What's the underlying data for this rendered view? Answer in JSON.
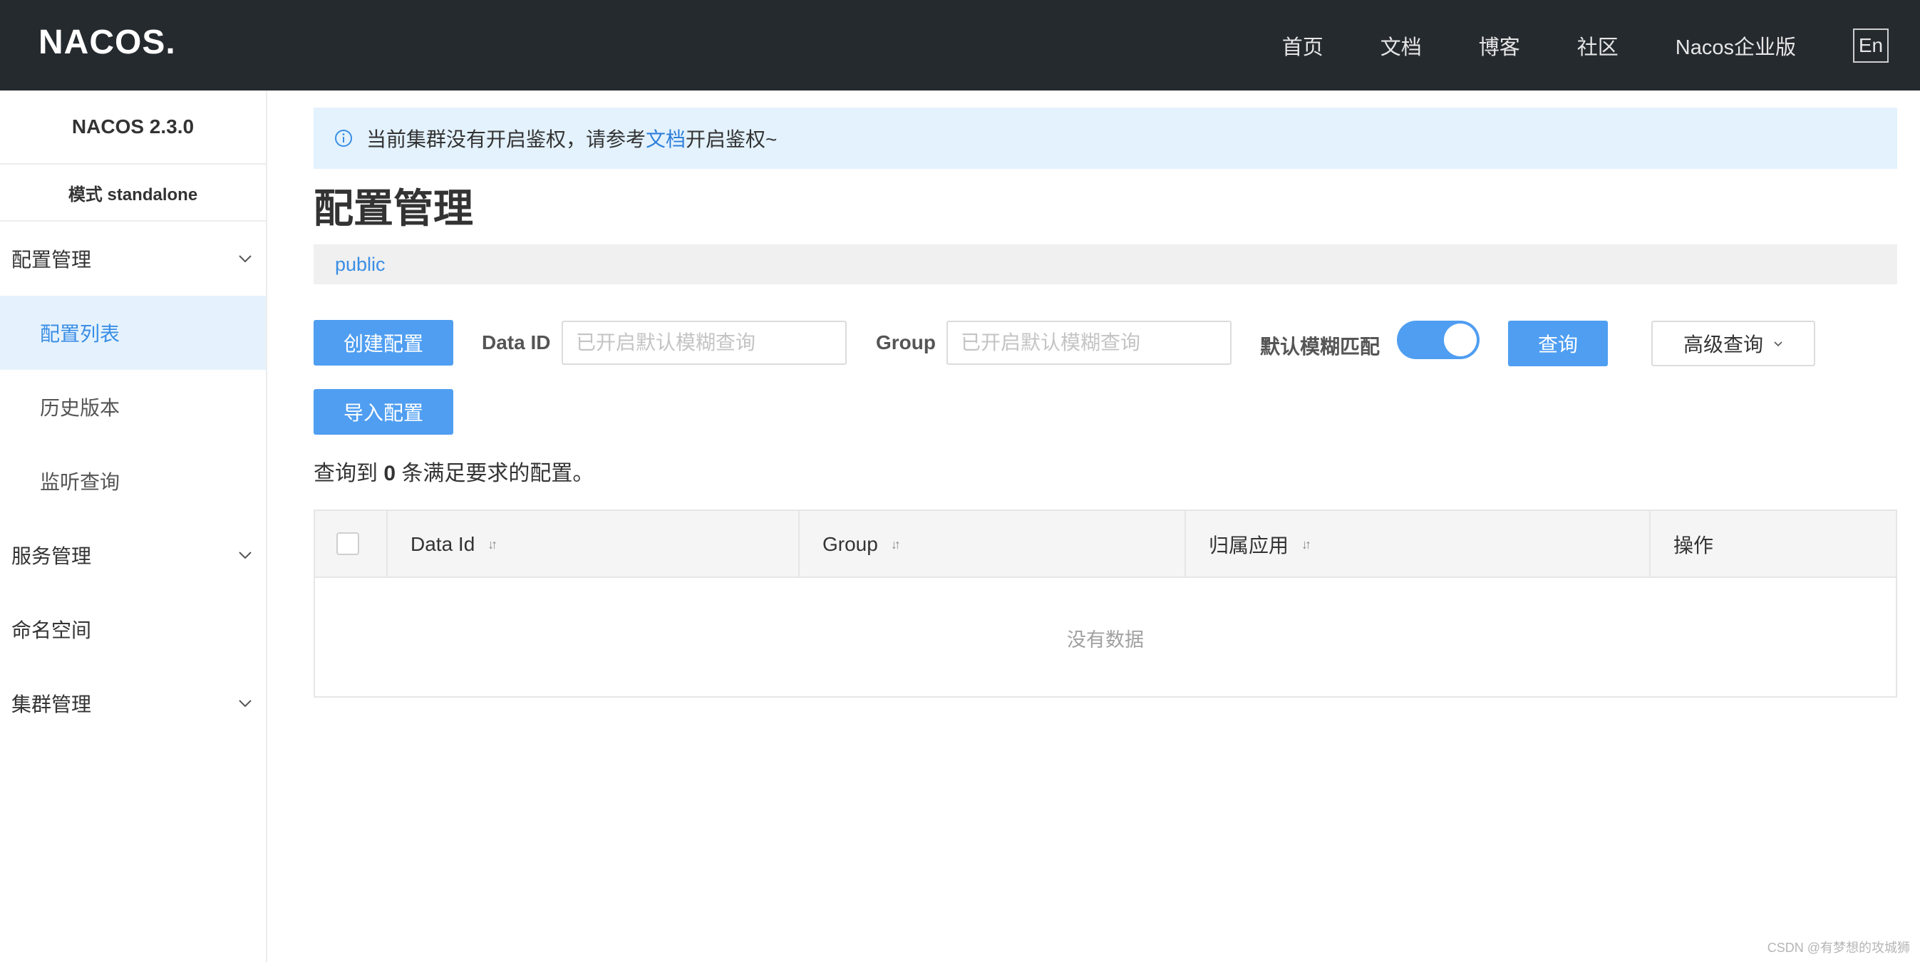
{
  "header": {
    "logo": "NACOS.",
    "nav": [
      "首页",
      "文档",
      "博客",
      "社区",
      "Nacos企业版"
    ],
    "lang_button": "En"
  },
  "sidebar": {
    "version": "NACOS 2.3.0",
    "mode": "模式 standalone",
    "groups": [
      {
        "label": "配置管理",
        "expanded": true,
        "items": [
          "配置列表",
          "历史版本",
          "监听查询"
        ],
        "active_item": "配置列表"
      },
      {
        "label": "服务管理",
        "expanded": false
      },
      {
        "label": "命名空间"
      },
      {
        "label": "集群管理",
        "expanded": false
      }
    ]
  },
  "alert": {
    "prefix": "当前集群没有开启鉴权，请参考",
    "link": "文档",
    "suffix": "开启鉴权~"
  },
  "page_title": "配置管理",
  "namespace": "public",
  "toolbar": {
    "create_button": "创建配置",
    "data_id_label": "Data ID",
    "data_id_placeholder": "已开启默认模糊查询",
    "group_label": "Group",
    "group_placeholder": "已开启默认模糊查询",
    "fuzzy_label": "默认模糊匹配",
    "fuzzy_enabled": true,
    "query_button": "查询",
    "advanced_button": "高级查询",
    "import_button": "导入配置"
  },
  "summary": {
    "prefix": "查询到",
    "count": "0",
    "suffix": "条满足要求的配置。"
  },
  "table": {
    "columns": [
      "Data Id",
      "Group",
      "归属应用",
      "操作"
    ],
    "rows": [],
    "empty_text": "没有数据"
  },
  "watermark": "CSDN @有梦想的攻城狮",
  "colors": {
    "header_bg": "#252a2f",
    "primary": "#4f9ef1",
    "link": "#3a8ee6",
    "alert_bg": "#e3f2fd",
    "active_menu_bg": "#e5f2fd"
  }
}
